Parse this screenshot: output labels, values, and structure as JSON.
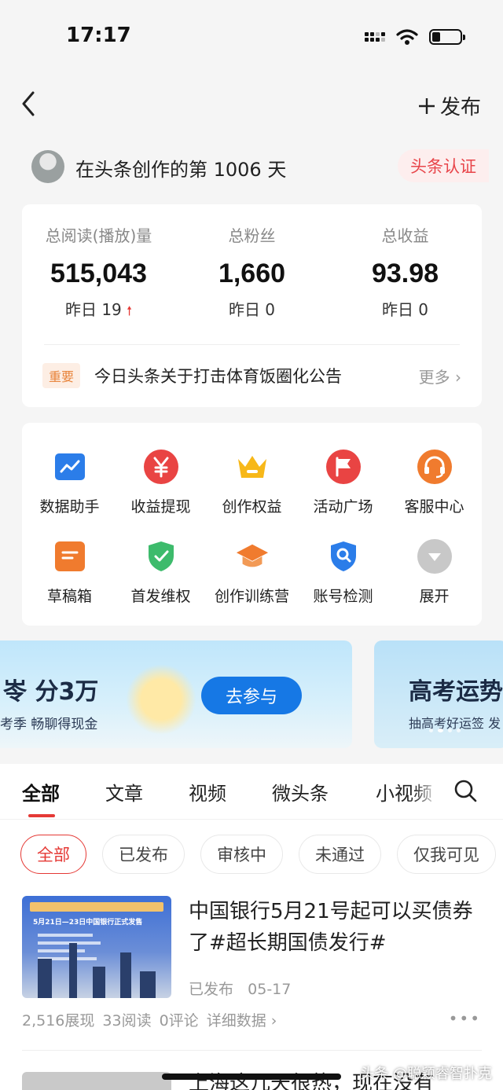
{
  "status_bar": {
    "time": "17:17"
  },
  "header": {
    "publish_label": "发布",
    "back_icon": "chevron-left-icon",
    "plus_icon": "plus-icon"
  },
  "creator": {
    "days_text": "在头条创作的第 1006 天",
    "verify_label": "头条认证"
  },
  "stats": [
    {
      "label": "总阅读(播放)量",
      "value": "515,043",
      "sub": "昨日 19",
      "trend": "up"
    },
    {
      "label": "总粉丝",
      "value": "1,660",
      "sub": "昨日 0"
    },
    {
      "label": "总收益",
      "value": "93.98",
      "sub": "昨日 0"
    }
  ],
  "notice": {
    "tag": "重要",
    "text": "今日头条关于打击体育饭圈化公告",
    "more": "更多"
  },
  "tools": [
    {
      "label": "数据助手",
      "icon": "chart-icon",
      "color": "#2b7de9"
    },
    {
      "label": "收益提现",
      "icon": "yen-icon",
      "color": "#e94443"
    },
    {
      "label": "创作权益",
      "icon": "crown-icon",
      "color": "#f7b819"
    },
    {
      "label": "活动广场",
      "icon": "flag-icon",
      "color": "#e94443"
    },
    {
      "label": "客服中心",
      "icon": "headset-icon",
      "color": "#f07b2e"
    },
    {
      "label": "草稿箱",
      "icon": "draft-icon",
      "color": "#f07b2e"
    },
    {
      "label": "首发维权",
      "icon": "shield-icon",
      "color": "#3dbb6c"
    },
    {
      "label": "创作训练营",
      "icon": "graduation-cap-icon",
      "color": "#f07b2e"
    },
    {
      "label": "账号检测",
      "icon": "search-shield-icon",
      "color": "#2b7de9"
    },
    {
      "label": "展开",
      "icon": "chevron-down-icon",
      "color": "#c8c8c8"
    }
  ],
  "banners": [
    {
      "title": "岺 分3万",
      "sub": "考季 畅聊得现金",
      "cta": "去参与"
    },
    {
      "title": "高考运势",
      "sub": "抽高考好运签 发"
    }
  ],
  "tabs": [
    "全部",
    "文章",
    "视频",
    "微头条",
    "小视频"
  ],
  "filters": [
    "全部",
    "已发布",
    "审核中",
    "未通过",
    "仅我可见"
  ],
  "article": {
    "thumb_caption": "5月21日—23日中国银行正式发售",
    "title": "中国银行5月21号起可以买债券了#超长期国债发行#",
    "status": "已发布",
    "date": "05-17",
    "impressions": "2,516展现",
    "reads": "33阅读",
    "comments": "0评论",
    "detail": "详细数据"
  },
  "next_article": {
    "title": "上海这几天很热，现在没有"
  },
  "watermark": "头条 @聪颖睿智扑克"
}
